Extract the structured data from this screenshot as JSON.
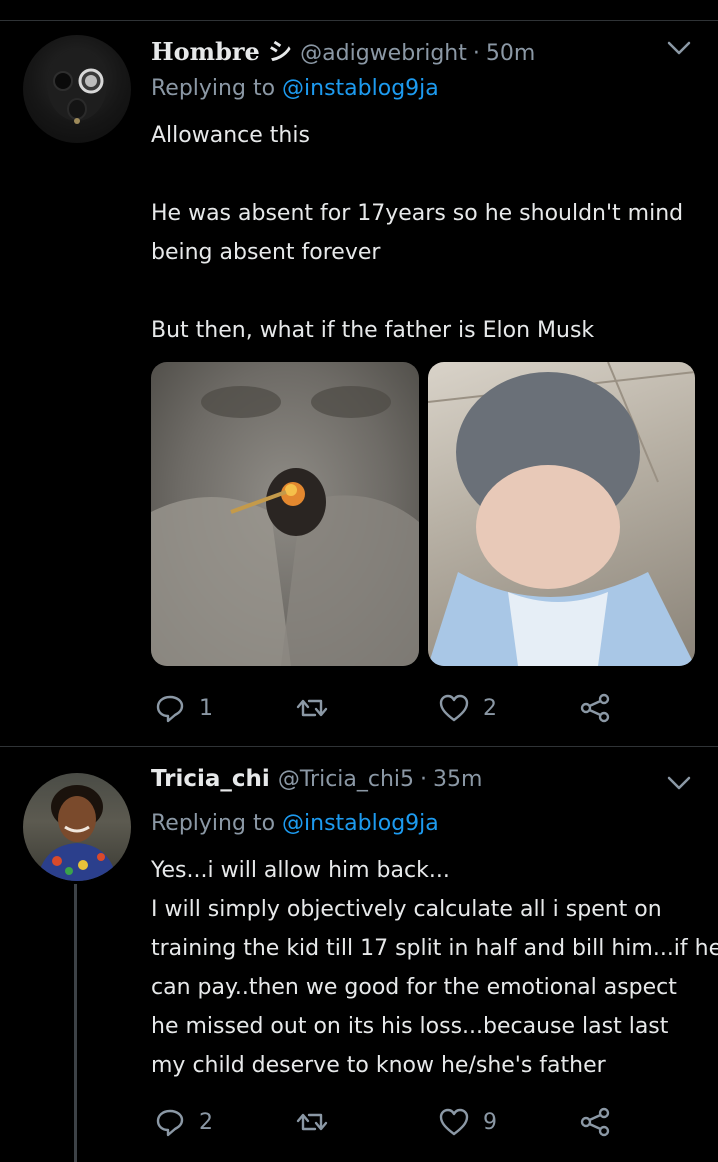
{
  "tweets": [
    {
      "display_name": "Hombre シ",
      "handle": "@adigwebright",
      "time": "50m",
      "replying_prefix": "Replying to ",
      "replying_to": "@instablog9ja",
      "text_lines": [
        "Allowance this",
        "",
        "He was absent for 17years so he shouldn't mind",
        "being absent forever",
        "",
        "But then, what if the father is Elon Musk"
      ],
      "replies": "1",
      "retweets": "",
      "likes": "2"
    },
    {
      "display_name": "Tricia_chi",
      "handle": "@Tricia_chi5",
      "time": "35m",
      "replying_prefix": "Replying to ",
      "replying_to": "@instablog9ja",
      "text_lines": [
        "Yes...i will allow him back...",
        "I will simply objectively calculate all i spent on",
        "training the kid till 17 split in half and bill him...if he",
        "can pay..then we good for the emotional aspect",
        "he missed out on its his loss...because last last",
        "my child deserve to know he/she's father"
      ],
      "replies": "2",
      "retweets": "",
      "likes": "9"
    }
  ],
  "colors": {
    "background": "#000000",
    "text": "#e7e9ea",
    "secondary": "#8b98a5",
    "link": "#1d9bf0",
    "divider": "#2f3336"
  },
  "icons": [
    "reply-icon",
    "retweet-icon",
    "like-icon",
    "share-icon",
    "chevron-down-icon"
  ]
}
